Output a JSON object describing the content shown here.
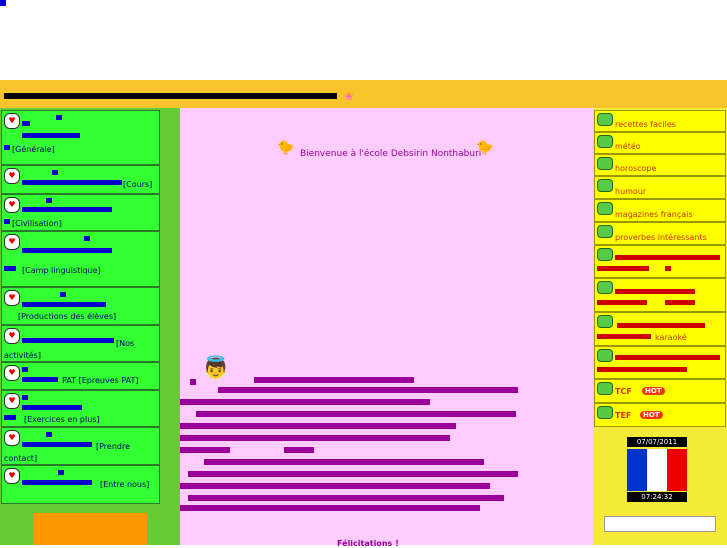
{
  "banner": {
    "flower": "❀"
  },
  "left_menu": {
    "items": [
      {
        "label": "[Générale]"
      },
      {
        "label": "[Cours]"
      },
      {
        "label": "[Civilisation]"
      },
      {
        "label": "[Camp linguistique]"
      },
      {
        "label": "[Productions des élèves]"
      },
      {
        "label": "[Nos activités]"
      },
      {
        "label": "PAT [Epreuves PAT]"
      },
      {
        "label": "[Exercices en plus]"
      },
      {
        "label": "[Prendre contact]"
      },
      {
        "label": "[Entre nous]"
      }
    ]
  },
  "center": {
    "welcome": "Bienvenue à l'école Debsirin Nonthaburi",
    "felicitations": "Félicitations !"
  },
  "right_menu": {
    "items": [
      {
        "label": "recettes faciles"
      },
      {
        "label": "météo"
      },
      {
        "label": "horoscope"
      },
      {
        "label": "humour"
      },
      {
        "label": "magazines français"
      },
      {
        "label": "proverbes intéressants"
      },
      {
        "label": ""
      },
      {
        "label": ""
      },
      {
        "label": "karaoké"
      },
      {
        "label": "TCF"
      },
      {
        "label": "TEF"
      }
    ],
    "hot_badge": "HOT"
  },
  "widget": {
    "date": "07/07/2011",
    "time": "07:24:32",
    "flag_colors": [
      "#0033cc",
      "#ffffff",
      "#ee0000"
    ]
  },
  "colors": {
    "banner": "#f7c52b",
    "left_panel": "#33ff33",
    "center_panel": "#ffccff",
    "right_panel": "#ffff00",
    "glyph_blocks_left": "#0000cc",
    "glyph_blocks_center": "#990099"
  },
  "icons": {
    "left_item_icon": "hello-kitty-icon",
    "right_item_icon": "frog-icon",
    "welcome_icon": "duck-icon",
    "angel_icon": "angel-icon"
  }
}
